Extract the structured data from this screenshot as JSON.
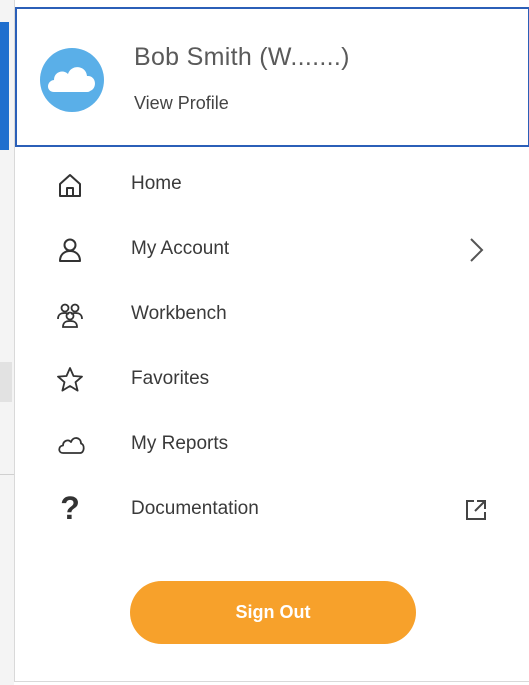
{
  "profile": {
    "name": "Bob Smith (W.......)",
    "view_profile": "View Profile",
    "avatar_icon": "cloud-avatar-icon"
  },
  "menu": {
    "items": [
      {
        "label": "Home",
        "icon": "home-icon"
      },
      {
        "label": "My Account",
        "icon": "person-icon",
        "trailing": "chevron-right-icon"
      },
      {
        "label": "Workbench",
        "icon": "people-group-icon"
      },
      {
        "label": "Favorites",
        "icon": "star-icon"
      },
      {
        "label": "My Reports",
        "icon": "cloud-icon"
      },
      {
        "label": "Documentation",
        "icon": "question-icon",
        "trailing": "external-link-icon"
      }
    ]
  },
  "sign_out": {
    "label": "Sign Out"
  },
  "colors": {
    "accent_blue": "#2b5fb8",
    "sign_out_orange": "#f7a12b",
    "avatar_blue": "#5aafe8"
  }
}
